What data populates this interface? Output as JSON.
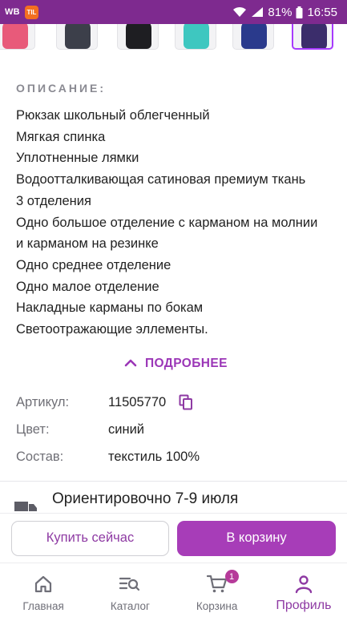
{
  "status_bar": {
    "carrier": "WB",
    "app_badge": "TIL",
    "battery": "81%",
    "time": "16:55"
  },
  "thumbnails": [
    {
      "color": "#e85a7a",
      "selected": false
    },
    {
      "color": "#3c3f4a",
      "selected": false
    },
    {
      "color": "#1e1e22",
      "selected": false
    },
    {
      "color": "#3ec7c0",
      "selected": false
    },
    {
      "color": "#2a3a8c",
      "selected": false
    },
    {
      "color": "#3b2d6b",
      "selected": true
    }
  ],
  "description": {
    "title": "ОПИСАНИЕ:",
    "lines": [
      "Рюкзак школьный облегченный",
      "Мягкая спинка",
      "Уплотненные лямки",
      "Водоотталкивающая сатиновая премиум ткань",
      "3 отделения",
      "Одно большое отделение с карманом на молнии",
      "и карманом на резинке",
      "Одно среднее отделение",
      "Одно малое отделение",
      "Накладные карманы по бокам",
      "Светоотражающие эллементы."
    ]
  },
  "more_link": "ПОДРОБНЕЕ",
  "specs": {
    "article_label": "Артикул:",
    "article_value": "11505770",
    "color_label": "Цвет:",
    "color_value": "синий",
    "composition_label": "Состав:",
    "composition_value": "текстиль 100%"
  },
  "delivery": {
    "text": "Ориентировочно 7-9 июля"
  },
  "actions": {
    "buy_now": "Купить сейчас",
    "add_to_cart": "В корзину"
  },
  "bottom_nav": {
    "home": "Главная",
    "catalog": "Каталог",
    "cart": "Корзина",
    "cart_count": "1",
    "profile": "Профиль"
  },
  "colors": {
    "brand": "#7e2a8f",
    "accent": "#a73db8",
    "link": "#9b36b7"
  }
}
